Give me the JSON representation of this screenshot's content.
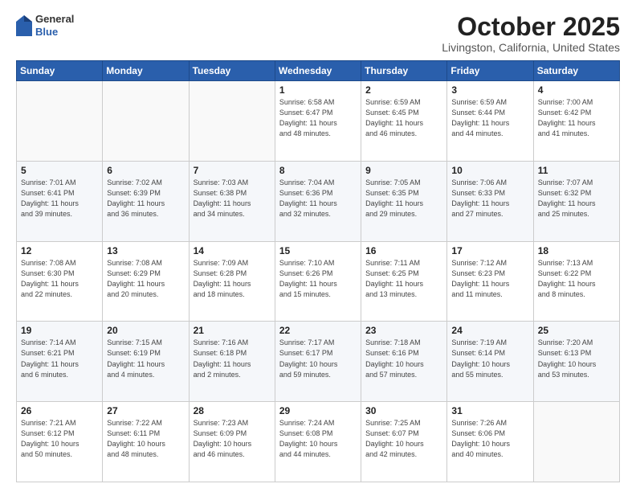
{
  "logo": {
    "general": "General",
    "blue": "Blue"
  },
  "header": {
    "month": "October 2025",
    "location": "Livingston, California, United States"
  },
  "days_of_week": [
    "Sunday",
    "Monday",
    "Tuesday",
    "Wednesday",
    "Thursday",
    "Friday",
    "Saturday"
  ],
  "weeks": [
    [
      {
        "day": "",
        "info": ""
      },
      {
        "day": "",
        "info": ""
      },
      {
        "day": "",
        "info": ""
      },
      {
        "day": "1",
        "info": "Sunrise: 6:58 AM\nSunset: 6:47 PM\nDaylight: 11 hours\nand 48 minutes."
      },
      {
        "day": "2",
        "info": "Sunrise: 6:59 AM\nSunset: 6:45 PM\nDaylight: 11 hours\nand 46 minutes."
      },
      {
        "day": "3",
        "info": "Sunrise: 6:59 AM\nSunset: 6:44 PM\nDaylight: 11 hours\nand 44 minutes."
      },
      {
        "day": "4",
        "info": "Sunrise: 7:00 AM\nSunset: 6:42 PM\nDaylight: 11 hours\nand 41 minutes."
      }
    ],
    [
      {
        "day": "5",
        "info": "Sunrise: 7:01 AM\nSunset: 6:41 PM\nDaylight: 11 hours\nand 39 minutes."
      },
      {
        "day": "6",
        "info": "Sunrise: 7:02 AM\nSunset: 6:39 PM\nDaylight: 11 hours\nand 36 minutes."
      },
      {
        "day": "7",
        "info": "Sunrise: 7:03 AM\nSunset: 6:38 PM\nDaylight: 11 hours\nand 34 minutes."
      },
      {
        "day": "8",
        "info": "Sunrise: 7:04 AM\nSunset: 6:36 PM\nDaylight: 11 hours\nand 32 minutes."
      },
      {
        "day": "9",
        "info": "Sunrise: 7:05 AM\nSunset: 6:35 PM\nDaylight: 11 hours\nand 29 minutes."
      },
      {
        "day": "10",
        "info": "Sunrise: 7:06 AM\nSunset: 6:33 PM\nDaylight: 11 hours\nand 27 minutes."
      },
      {
        "day": "11",
        "info": "Sunrise: 7:07 AM\nSunset: 6:32 PM\nDaylight: 11 hours\nand 25 minutes."
      }
    ],
    [
      {
        "day": "12",
        "info": "Sunrise: 7:08 AM\nSunset: 6:30 PM\nDaylight: 11 hours\nand 22 minutes."
      },
      {
        "day": "13",
        "info": "Sunrise: 7:08 AM\nSunset: 6:29 PM\nDaylight: 11 hours\nand 20 minutes."
      },
      {
        "day": "14",
        "info": "Sunrise: 7:09 AM\nSunset: 6:28 PM\nDaylight: 11 hours\nand 18 minutes."
      },
      {
        "day": "15",
        "info": "Sunrise: 7:10 AM\nSunset: 6:26 PM\nDaylight: 11 hours\nand 15 minutes."
      },
      {
        "day": "16",
        "info": "Sunrise: 7:11 AM\nSunset: 6:25 PM\nDaylight: 11 hours\nand 13 minutes."
      },
      {
        "day": "17",
        "info": "Sunrise: 7:12 AM\nSunset: 6:23 PM\nDaylight: 11 hours\nand 11 minutes."
      },
      {
        "day": "18",
        "info": "Sunrise: 7:13 AM\nSunset: 6:22 PM\nDaylight: 11 hours\nand 8 minutes."
      }
    ],
    [
      {
        "day": "19",
        "info": "Sunrise: 7:14 AM\nSunset: 6:21 PM\nDaylight: 11 hours\nand 6 minutes."
      },
      {
        "day": "20",
        "info": "Sunrise: 7:15 AM\nSunset: 6:19 PM\nDaylight: 11 hours\nand 4 minutes."
      },
      {
        "day": "21",
        "info": "Sunrise: 7:16 AM\nSunset: 6:18 PM\nDaylight: 11 hours\nand 2 minutes."
      },
      {
        "day": "22",
        "info": "Sunrise: 7:17 AM\nSunset: 6:17 PM\nDaylight: 10 hours\nand 59 minutes."
      },
      {
        "day": "23",
        "info": "Sunrise: 7:18 AM\nSunset: 6:16 PM\nDaylight: 10 hours\nand 57 minutes."
      },
      {
        "day": "24",
        "info": "Sunrise: 7:19 AM\nSunset: 6:14 PM\nDaylight: 10 hours\nand 55 minutes."
      },
      {
        "day": "25",
        "info": "Sunrise: 7:20 AM\nSunset: 6:13 PM\nDaylight: 10 hours\nand 53 minutes."
      }
    ],
    [
      {
        "day": "26",
        "info": "Sunrise: 7:21 AM\nSunset: 6:12 PM\nDaylight: 10 hours\nand 50 minutes."
      },
      {
        "day": "27",
        "info": "Sunrise: 7:22 AM\nSunset: 6:11 PM\nDaylight: 10 hours\nand 48 minutes."
      },
      {
        "day": "28",
        "info": "Sunrise: 7:23 AM\nSunset: 6:09 PM\nDaylight: 10 hours\nand 46 minutes."
      },
      {
        "day": "29",
        "info": "Sunrise: 7:24 AM\nSunset: 6:08 PM\nDaylight: 10 hours\nand 44 minutes."
      },
      {
        "day": "30",
        "info": "Sunrise: 7:25 AM\nSunset: 6:07 PM\nDaylight: 10 hours\nand 42 minutes."
      },
      {
        "day": "31",
        "info": "Sunrise: 7:26 AM\nSunset: 6:06 PM\nDaylight: 10 hours\nand 40 minutes."
      },
      {
        "day": "",
        "info": ""
      }
    ]
  ]
}
